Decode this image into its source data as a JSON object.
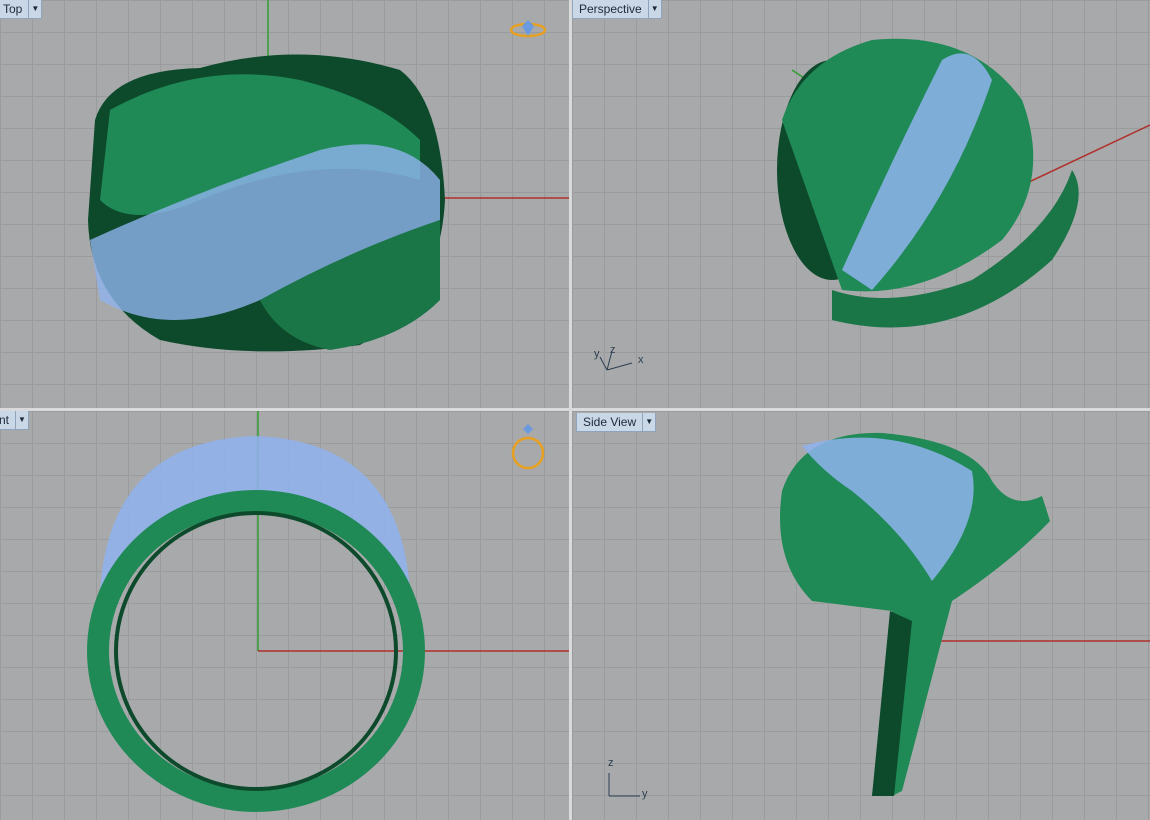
{
  "viewports": {
    "top": {
      "label": "Top",
      "widget_icon": "ring-gem-widget-icon"
    },
    "perspective": {
      "label": "Perspective",
      "widget_icon": "none"
    },
    "front": {
      "label": "Front",
      "widget_icon": "ring-widget-icon"
    },
    "side": {
      "label": "Side View",
      "widget_icon": "none"
    }
  },
  "axes": {
    "perspective": {
      "x": "x",
      "y": "y",
      "z": "z"
    },
    "side": {
      "z": "z",
      "y": "y"
    }
  },
  "colors": {
    "metal": "#1f8a55",
    "metal_dark": "#0d4a2c",
    "stone": "#8fb3ee",
    "axis_x": "#b0302a",
    "axis_y": "#30a030",
    "grid": "#9a9b9d",
    "background": "#a8a9ab"
  }
}
